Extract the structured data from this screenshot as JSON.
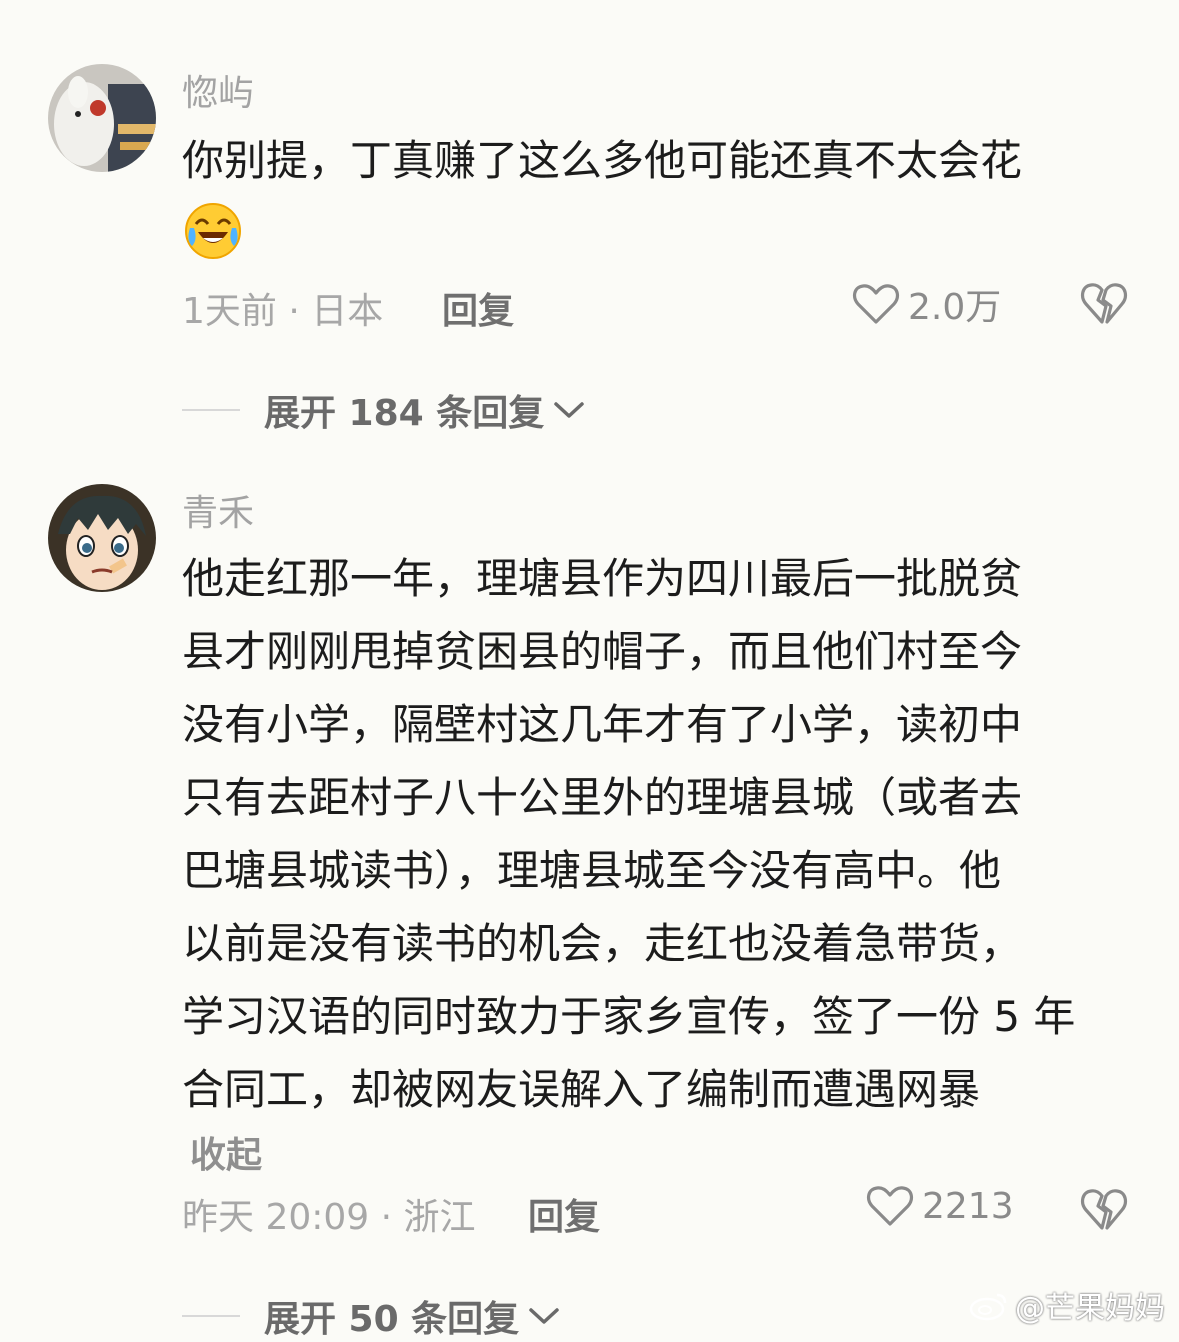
{
  "comments": [
    {
      "username": "惚屿",
      "text": "你别提，丁真赚了这么多他可能还真不太会花",
      "emoji": "crying-laughing-emoji",
      "meta": "1天前 · 日本",
      "reply_label": "回复",
      "likes": "2.0万",
      "expand_label": "展开 184 条回复"
    },
    {
      "username": "青禾",
      "text": "他走红那一年，理塘县作为四川最后一批脱贫\n县才刚刚甩掉贫困县的帽子，而且他们村至今\n没有小学，隔壁村这几年才有了小学，读初中\n只有去距村子八十公里外的理塘县城（或者去\n巴塘县城读书），理塘县城至今没有高中。他\n以前是没有读书的机会，走红也没着急带货，\n学习汉语的同时致力于家乡宣传，签了一份 5 年\n合同工，却被网友误解入了编制而遭遇网暴",
      "collapse_label": "收起",
      "meta": "昨天 20:09 · 浙江",
      "reply_label": "回复",
      "likes": "2213",
      "expand_label": "展开 50 条回复"
    }
  ],
  "watermark": "@芒果妈妈",
  "colors": {
    "background": "#fbfbf7",
    "text": "#1c1c1c",
    "muted": "#a7a7a7"
  }
}
